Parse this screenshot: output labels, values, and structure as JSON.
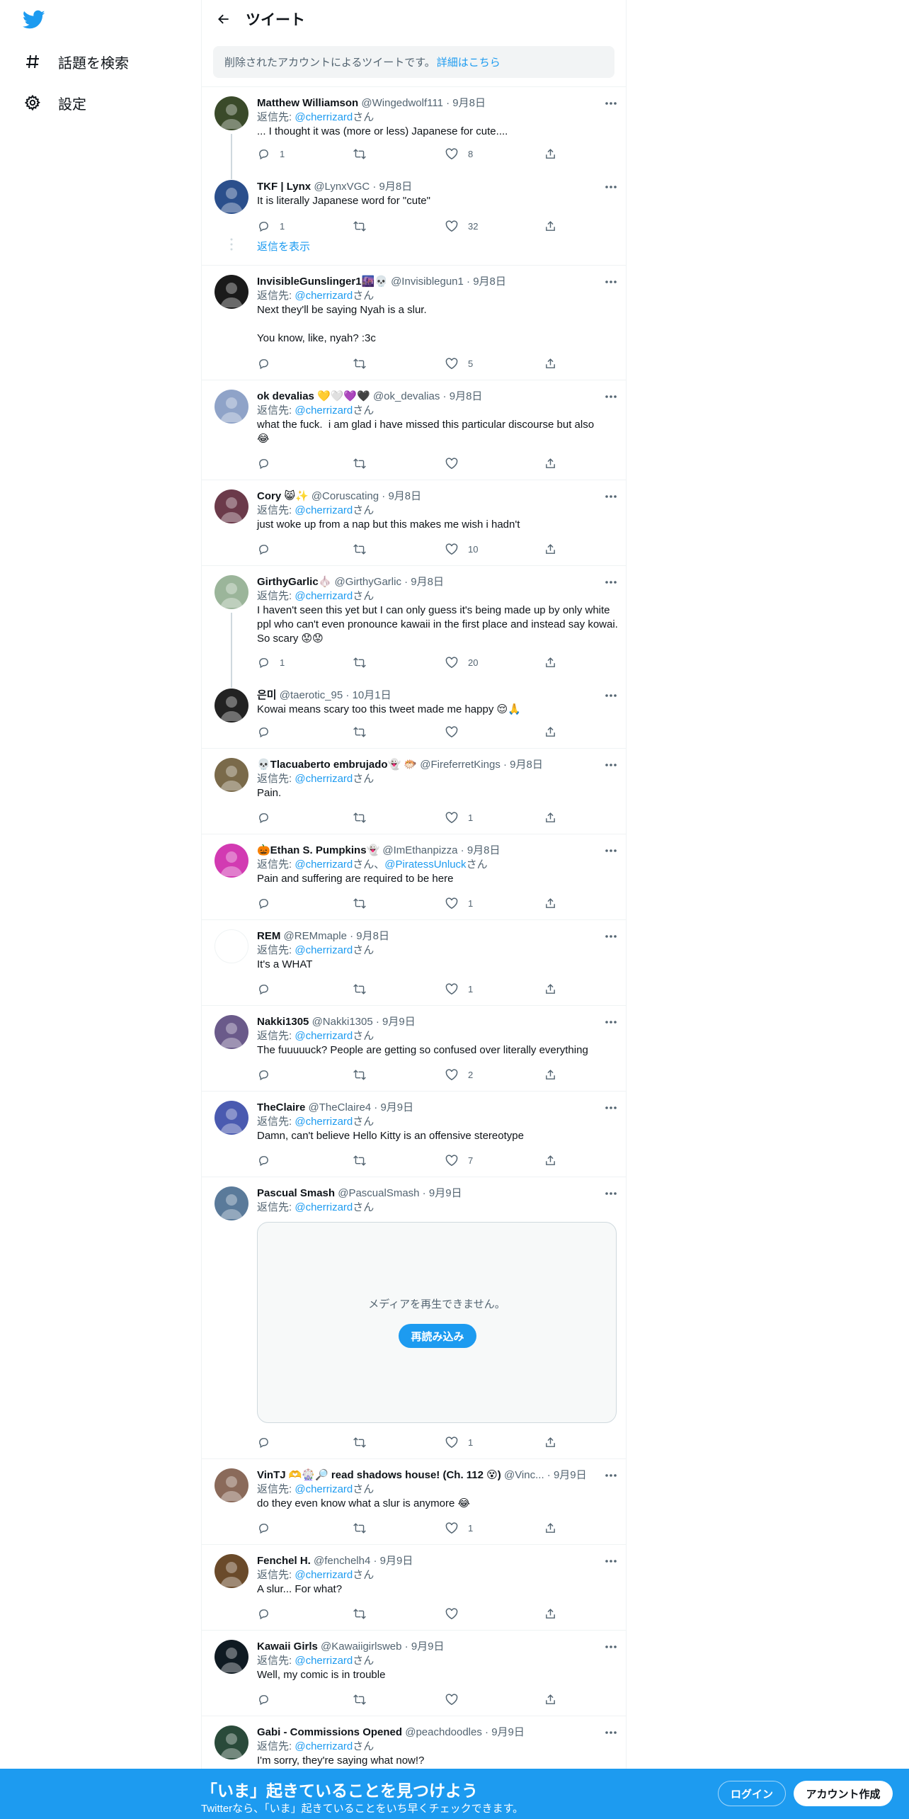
{
  "sidebar": {
    "logo_icon": "twitter-bird-icon",
    "items": [
      {
        "label": "話題を検索",
        "icon": "hashtag-icon"
      },
      {
        "label": "設定",
        "icon": "gear-icon"
      }
    ]
  },
  "header": {
    "title": "ツイート",
    "back_icon": "arrow-left-icon"
  },
  "notice": {
    "text": "削除されたアカウントによるツイートです。",
    "link": "詳細はこちら"
  },
  "reply_prefix": "返信先: ",
  "san": "さん",
  "show_replies": "返信を表示",
  "colors": {
    "accent": "#1d9bf0",
    "text": "#0f1419",
    "muted": "#536471",
    "border": "#eff3f4"
  },
  "tweets": [
    {
      "name": "Matthew Williamson",
      "handle": "@Wingedwolf111",
      "date": " · 9月8日",
      "reply_to": "@cherrizard",
      "text": "... I thought it was (more or less) Japanese for cute....",
      "replies": "1",
      "retweets": "",
      "likes": "8",
      "avatar": "#3a4a2a"
    },
    {
      "name": "TKF | Lynx",
      "handle": "@LynxVGC",
      "date": " · 9月8日",
      "reply_to": "",
      "text": "It is literally Japanese word for \"cute\"",
      "replies": "1",
      "retweets": "",
      "likes": "32",
      "avatar": "#2b4f8c"
    },
    {
      "name": "InvisibleGunslinger1🌆💀",
      "handle": "@Invisiblegun1",
      "date": " · 9月8日",
      "reply_to": "@cherrizard",
      "text": "Next they'll be saying Nyah is a slur.\n\nYou know, like, nyah? :3c",
      "replies": "",
      "retweets": "",
      "likes": "5",
      "avatar": "#1a1a1a"
    },
    {
      "name": "ok devalias 💛🤍💜🖤",
      "handle": "@ok_devalias",
      "date": " · 9月8日",
      "reply_to": "@cherrizard",
      "text": "what the fuck.  i am glad i have missed this particular discourse but also\n😂",
      "replies": "",
      "retweets": "",
      "likes": "",
      "avatar": "#8fa3c8"
    },
    {
      "name": "Cory 😸✨",
      "handle": "@Coruscating",
      "date": " · 9月8日",
      "reply_to": "@cherrizard",
      "text": "just woke up from a nap but this makes me wish i hadn't",
      "replies": "",
      "retweets": "",
      "likes": "10",
      "avatar": "#6b3a4a"
    },
    {
      "name": "GirthyGarlic🧄",
      "handle": "@GirthyGarlic",
      "date": " · 9月8日",
      "reply_to": "@cherrizard",
      "text": "I haven't seen this yet but I can only guess it's being made up by only white ppl who can't even pronounce kawaii in the first place and instead say kowai. So scary 😟😟",
      "replies": "1",
      "retweets": "",
      "likes": "20",
      "avatar": "#9bb59a"
    },
    {
      "name": "은미",
      "handle": "@taerotic_95",
      "date": " · 10月1日",
      "reply_to": "",
      "text": "Kowai means scary too this tweet made me happy 😌🙏",
      "replies": "",
      "retweets": "",
      "likes": "",
      "avatar": "#222222"
    },
    {
      "name": "💀Tlacuaberto embrujado👻 🐡",
      "handle": "@FireferretKings",
      "date": " · 9月8日",
      "reply_to": "@cherrizard",
      "text": "Pain.",
      "replies": "",
      "retweets": "",
      "likes": "1",
      "avatar": "#7a6a4a"
    },
    {
      "name": "🎃Ethan S. Pumpkins👻",
      "handle": "@ImEthanpizza",
      "date": " · 9月8日",
      "reply_to": "@cherrizard",
      "reply_to2": "@PiratessUnluck",
      "text": "Pain and suffering are required to be here",
      "replies": "",
      "retweets": "",
      "likes": "1",
      "avatar": "#d23ab2"
    },
    {
      "name": "REM",
      "handle": "@REMmaple",
      "date": " · 9月8日",
      "reply_to": "@cherrizard",
      "text": "It's a WHAT",
      "replies": "",
      "retweets": "",
      "likes": "1",
      "avatar": "#ffffff"
    },
    {
      "name": "Nakki1305",
      "handle": "@Nakki1305",
      "date": " · 9月9日",
      "reply_to": "@cherrizard",
      "text": "The fuuuuuck? People are getting so confused over literally everything",
      "replies": "",
      "retweets": "",
      "likes": "2",
      "avatar": "#6a5a8a"
    },
    {
      "name": "TheClaire",
      "handle": "@TheClaire4",
      "date": " · 9月9日",
      "reply_to": "@cherrizard",
      "text": "Damn, can't believe Hello Kitty is an offensive stereotype",
      "replies": "",
      "retweets": "",
      "likes": "7",
      "avatar": "#4a5ab0"
    },
    {
      "name": "Pascual Smash",
      "handle": "@PascualSmash",
      "date": " · 9月9日",
      "reply_to": "@cherrizard",
      "text": "",
      "replies": "",
      "retweets": "",
      "likes": "1",
      "avatar": "#5a7a9a",
      "media": {
        "message": "メディアを再生できません。",
        "button": "再読み込み"
      }
    },
    {
      "name": "VinTJ 🫶🎡🔎 read shadows house! (Ch. 112 😵)",
      "handle": "@Vinc...",
      "date": " · 9月9日",
      "reply_to": "@cherrizard",
      "text": "do they even know what a slur is anymore 😂",
      "replies": "",
      "retweets": "",
      "likes": "1",
      "avatar": "#8a6a5a"
    },
    {
      "name": "Fenchel H.",
      "handle": "@fenchelh4",
      "date": " · 9月9日",
      "reply_to": "@cherrizard",
      "text": "A slur... For what?",
      "replies": "",
      "retweets": "",
      "likes": "",
      "avatar": "#6a4a2a"
    },
    {
      "name": "Kawaii Girls",
      "handle": "@Kawaiigirlsweb",
      "date": " · 9月9日",
      "reply_to": "@cherrizard",
      "text": "Well, my comic is in trouble",
      "replies": "",
      "retweets": "",
      "likes": "",
      "avatar": "#0f1a22"
    },
    {
      "name": "Gabi - Commissions Opened",
      "handle": "@peachdoodles",
      "date": " · 9月9日",
      "reply_to": "@cherrizard",
      "text": "I'm sorry, they're saying what now!?",
      "replies": "",
      "retweets": "",
      "likes": "",
      "avatar": "#2a4a3a"
    }
  ],
  "bottom_bar": {
    "title": "「いま」起きていることを見つけよう",
    "subtitle": "Twitterなら、「いま」起きていることをいち早くチェックできます。",
    "login": "ログイン",
    "signup": "アカウント作成"
  }
}
